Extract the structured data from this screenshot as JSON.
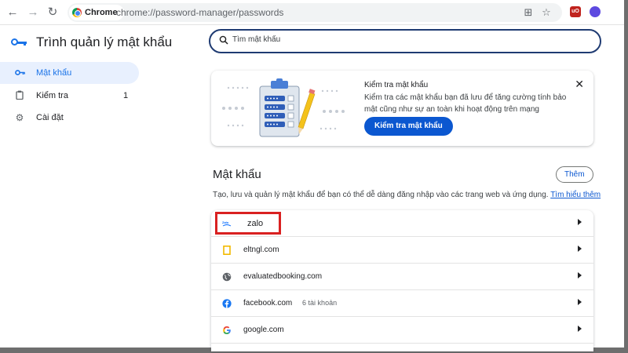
{
  "browser": {
    "chip_label": "Chrome",
    "url": "chrome://password-manager/passwords",
    "icons": [
      "back-icon",
      "forward-icon",
      "reload-icon",
      "install-icon",
      "star-icon"
    ],
    "extensions": [
      {
        "name": "ublock-icon",
        "label": "uO",
        "color": "#c0231e"
      },
      {
        "name": "extension-icon",
        "label": "",
        "color": "#5d49e0"
      }
    ]
  },
  "app": {
    "title": "Trình quản lý mật khẩu",
    "accent_color": "#1a73e8"
  },
  "sidebar": {
    "items": [
      {
        "label": "Mật khẩu",
        "icon": "key-icon",
        "active": true
      },
      {
        "label": "Kiểm tra",
        "icon": "clipboard-icon",
        "count": "1"
      },
      {
        "label": "Cài đặt",
        "icon": "gear-icon"
      }
    ]
  },
  "search": {
    "placeholder": "Tìm mật khẩu",
    "value": ""
  },
  "checkup_card": {
    "title": "Kiểm tra mật khẩu",
    "description": "Kiểm tra các mật khẩu bạn đã lưu để tăng cường tính bảo mật cũng như sự an toàn khi hoạt động trên mạng",
    "button_label": "Kiểm tra mật khẩu"
  },
  "passwords_section": {
    "title": "Mật khẩu",
    "add_label": "Thêm",
    "description": "Tạo, lưu và quản lý mật khẩu để bạn có thể dễ dàng đăng nhập vào các trang web và ứng dụng.",
    "learn_more": "Tìm hiểu thêm",
    "items": [
      {
        "site": "zalo",
        "icon": "zalo-icon",
        "accounts": "",
        "highlighted": true
      },
      {
        "site": "eltngl.com",
        "icon": "eltngl-icon",
        "accounts": ""
      },
      {
        "site": "evaluatedbooking.com",
        "icon": "globe-icon",
        "accounts": ""
      },
      {
        "site": "facebook.com",
        "icon": "facebook-icon",
        "accounts": "6 tài khoản"
      },
      {
        "site": "google.com",
        "icon": "google-icon",
        "accounts": ""
      }
    ]
  },
  "annotation": {
    "highlight_color": "#d92121"
  }
}
